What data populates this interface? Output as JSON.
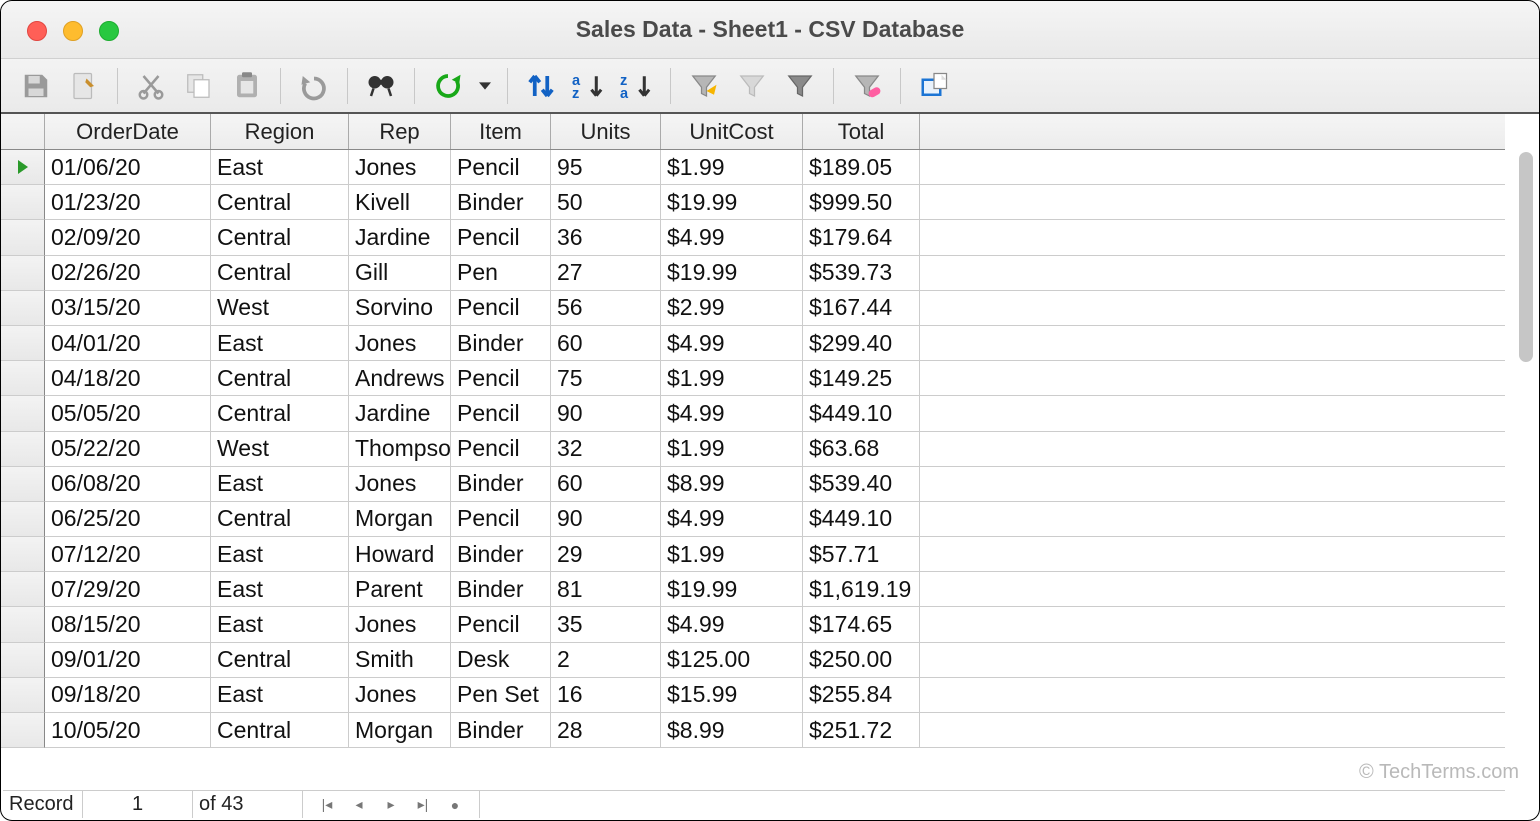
{
  "window": {
    "title": "Sales Data - Sheet1 - CSV Database"
  },
  "toolbar": {
    "save": "Save",
    "edit": "Edit",
    "cut": "Cut",
    "copy": "Copy",
    "paste": "Paste",
    "undo": "Undo",
    "find": "Find",
    "refresh": "Refresh",
    "sort": "Sort",
    "sort_asc": "Sort Ascending",
    "sort_desc": "Sort Descending",
    "autofilter": "AutoFilter",
    "apply_filter": "Apply Filter",
    "standard_filter": "Standard Filter",
    "remove_filter": "Remove Filter",
    "data_sources": "Data Sources"
  },
  "columns": [
    "OrderDate",
    "Region",
    "Rep",
    "Item",
    "Units",
    "UnitCost",
    "Total"
  ],
  "rows": [
    [
      "01/06/20",
      "East",
      "Jones",
      "Pencil",
      "95",
      "$1.99",
      "$189.05"
    ],
    [
      "01/23/20",
      "Central",
      "Kivell",
      "Binder",
      "50",
      "$19.99",
      "$999.50"
    ],
    [
      "02/09/20",
      "Central",
      "Jardine",
      "Pencil",
      "36",
      "$4.99",
      "$179.64"
    ],
    [
      "02/26/20",
      "Central",
      "Gill",
      "Pen",
      "27",
      "$19.99",
      "$539.73"
    ],
    [
      "03/15/20",
      "West",
      "Sorvino",
      "Pencil",
      "56",
      "$2.99",
      "$167.44"
    ],
    [
      "04/01/20",
      "East",
      "Jones",
      "Binder",
      "60",
      "$4.99",
      "$299.40"
    ],
    [
      "04/18/20",
      "Central",
      "Andrews",
      "Pencil",
      "75",
      "$1.99",
      "$149.25"
    ],
    [
      "05/05/20",
      "Central",
      "Jardine",
      "Pencil",
      "90",
      "$4.99",
      "$449.10"
    ],
    [
      "05/22/20",
      "West",
      "Thompson",
      "Pencil",
      "32",
      "$1.99",
      "$63.68"
    ],
    [
      "06/08/20",
      "East",
      "Jones",
      "Binder",
      "60",
      "$8.99",
      "$539.40"
    ],
    [
      "06/25/20",
      "Central",
      "Morgan",
      "Pencil",
      "90",
      "$4.99",
      "$449.10"
    ],
    [
      "07/12/20",
      "East",
      "Howard",
      "Binder",
      "29",
      "$1.99",
      "$57.71"
    ],
    [
      "07/29/20",
      "East",
      "Parent",
      "Binder",
      "81",
      "$19.99",
      "$1,619.19"
    ],
    [
      "08/15/20",
      "East",
      "Jones",
      "Pencil",
      "35",
      "$4.99",
      "$174.65"
    ],
    [
      "09/01/20",
      "Central",
      "Smith",
      "Desk",
      "2",
      "$125.00",
      "$250.00"
    ],
    [
      "09/18/20",
      "East",
      "Jones",
      "Pen Set",
      "16",
      "$15.99",
      "$255.84"
    ],
    [
      "10/05/20",
      "Central",
      "Morgan",
      "Binder",
      "28",
      "$8.99",
      "$251.72"
    ]
  ],
  "status": {
    "record_label": "Record",
    "current": "1",
    "of_label": "of 43"
  },
  "footer": {
    "brand": "© TechTerms.com"
  }
}
